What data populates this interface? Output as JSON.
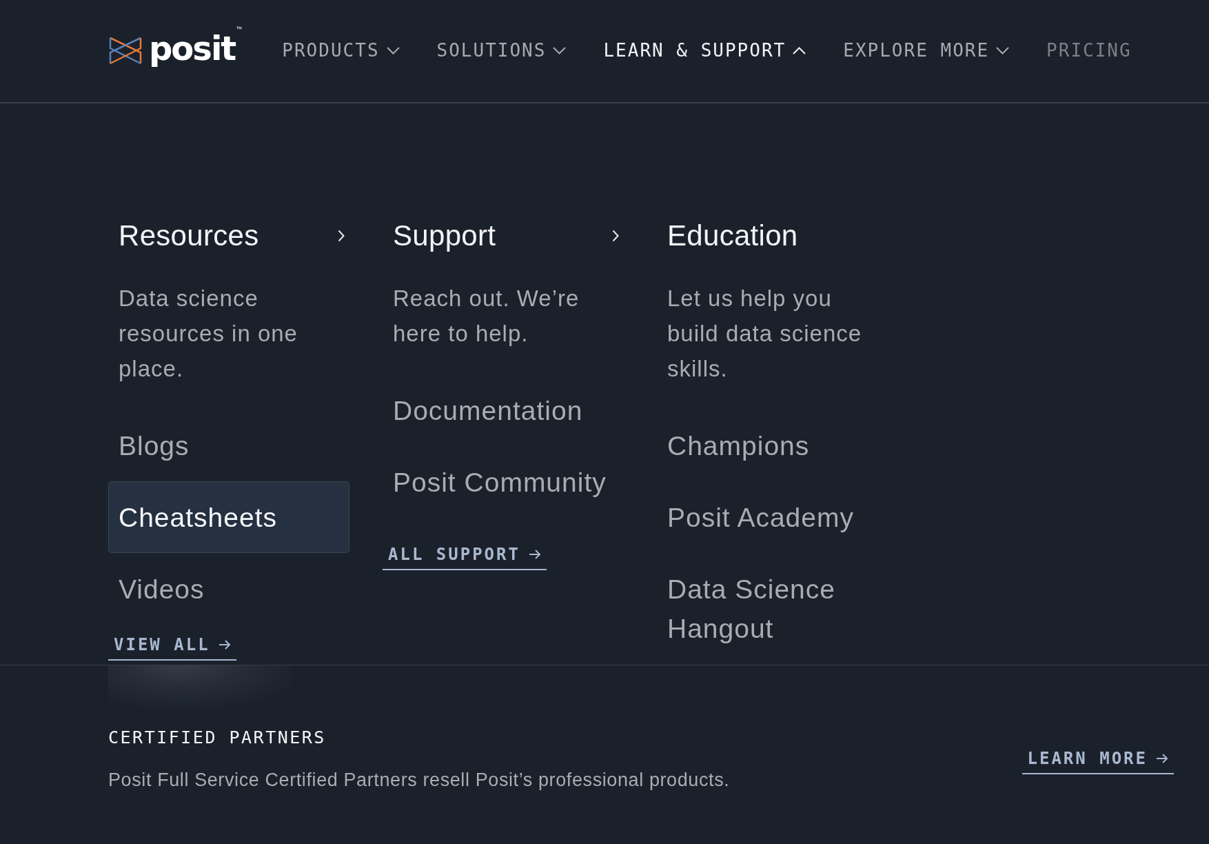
{
  "logo": {
    "wordmark": "posit",
    "trademark": "™"
  },
  "nav": [
    {
      "label": "PRODUCTS",
      "kind": "dropdown",
      "expanded": false
    },
    {
      "label": "SOLUTIONS",
      "kind": "dropdown",
      "expanded": false
    },
    {
      "label": "LEARN & SUPPORT",
      "kind": "dropdown",
      "expanded": true
    },
    {
      "label": "EXPLORE MORE",
      "kind": "dropdown",
      "expanded": false
    },
    {
      "label": "PRICING",
      "kind": "link"
    }
  ],
  "menu": {
    "columns": [
      {
        "title": "Resources",
        "has_submenu": true,
        "description": "Data science resources in one place.",
        "items": [
          {
            "label": "Blogs",
            "selected": false
          },
          {
            "label": "Cheatsheets",
            "selected": true
          },
          {
            "label": "Videos",
            "selected": false
          }
        ],
        "link": "VIEW ALL"
      },
      {
        "title": "Support",
        "has_submenu": true,
        "description": "Reach out. We’re here to help.",
        "items": [
          {
            "label": "Documentation",
            "selected": false
          },
          {
            "label": "Posit Community",
            "selected": false
          }
        ],
        "link": "ALL SUPPORT"
      },
      {
        "title": "Education",
        "has_submenu": false,
        "description": "Let us help you build data science skills.",
        "items": [
          {
            "label": "Champions",
            "selected": false
          },
          {
            "label": "Posit Academy",
            "selected": false
          },
          {
            "label": "Data Science Hangout",
            "selected": false
          }
        ]
      }
    ]
  },
  "footer": {
    "title": "CERTIFIED PARTNERS",
    "text": "Posit Full Service Certified Partners resell Posit’s professional products.",
    "link": "LEARN MORE"
  }
}
